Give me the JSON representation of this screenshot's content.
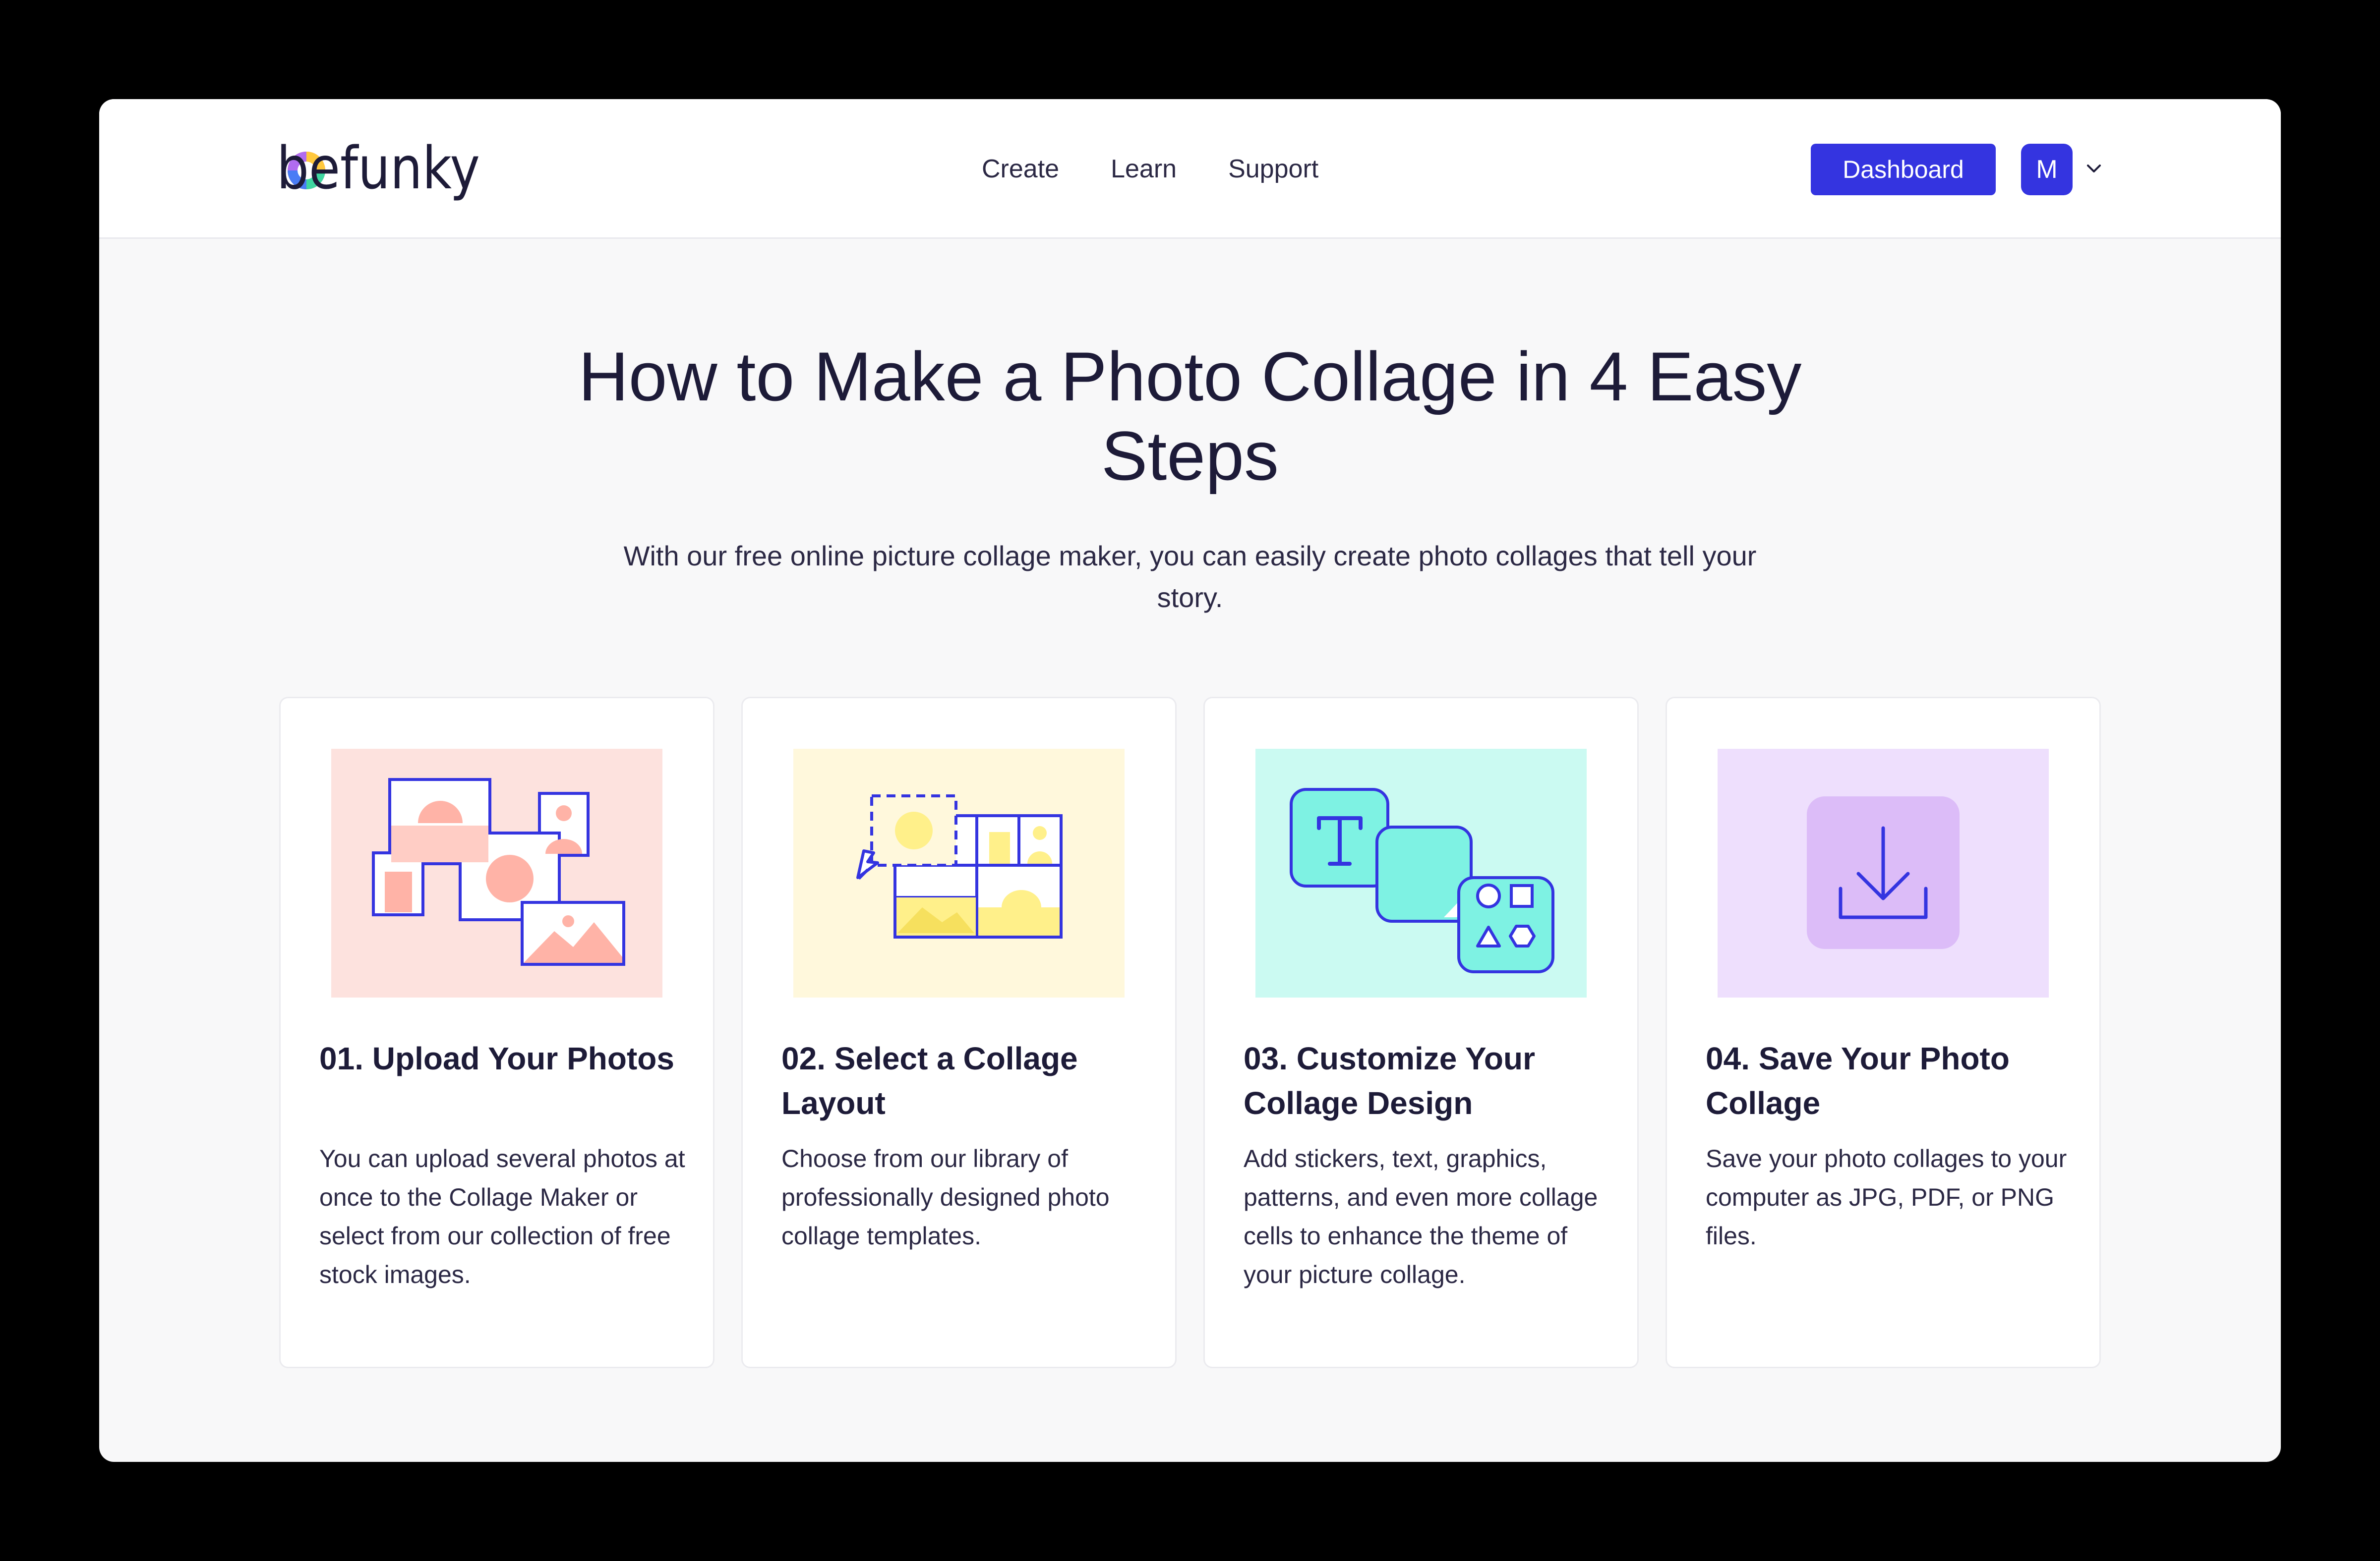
{
  "brand": {
    "logo_text": "befunky"
  },
  "nav": {
    "links": [
      "Create",
      "Learn",
      "Support"
    ],
    "dashboard_label": "Dashboard",
    "avatar_initial": "M"
  },
  "hero": {
    "title": "How to Make a Photo Collage in 4 Easy Steps",
    "subtitle": "With our free online picture collage maker, you can easily create photo collages that tell your story."
  },
  "steps": [
    {
      "title": "01. Upload Your Photos",
      "text": "You can upload several photos at once to the Collage Maker or select from our collection of free stock images.",
      "bg_color": "#fde2de"
    },
    {
      "title": "02. Select a Collage Layout",
      "text": "Choose from our library of professionally designed photo collage templates.",
      "bg_color": "#fff8dc"
    },
    {
      "title": "03. Customize Your Collage Design",
      "text": "Add stickers, text, graphics, patterns, and even more collage cells to enhance the theme of your picture collage.",
      "bg_color": "#cbfaf2"
    },
    {
      "title": "04. Save Your Photo Collage",
      "text": "Save your photo collages to your computer as JPG, PDF, or PNG files.",
      "bg_color": "#eedffd"
    }
  ],
  "colors": {
    "accent": "#3434e0",
    "text_dark": "#1d1b38",
    "page_bg": "#f8f8f9"
  }
}
